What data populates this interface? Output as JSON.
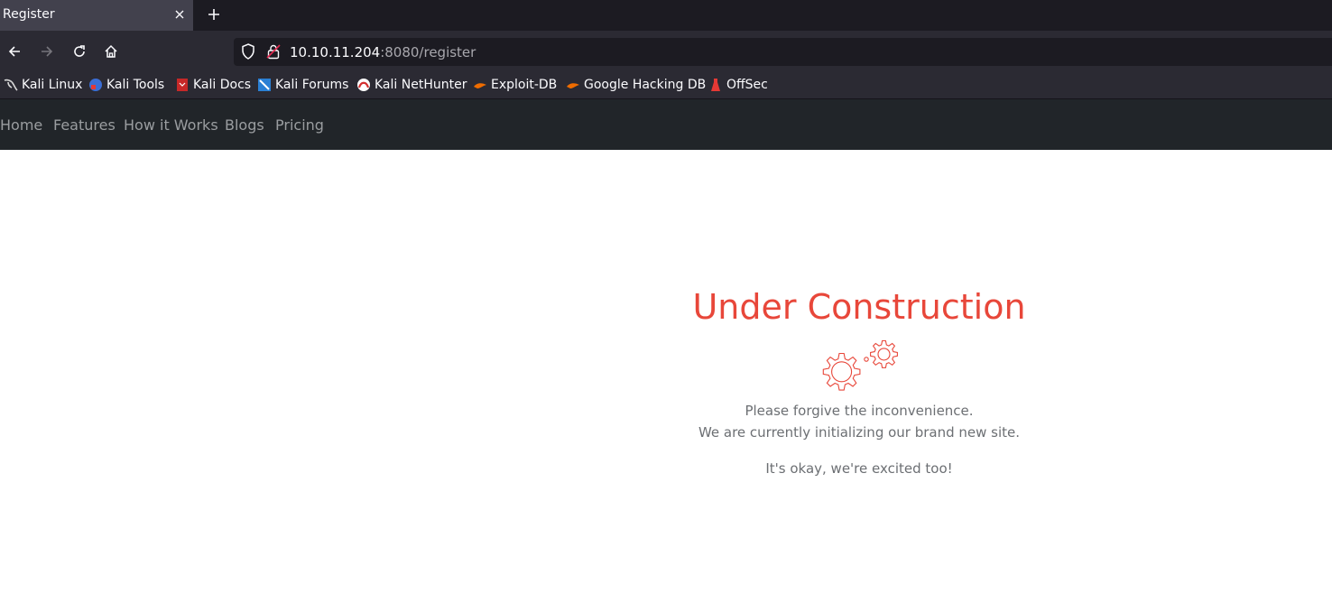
{
  "browser": {
    "tab": {
      "title": "Register"
    },
    "url": {
      "host": "10.10.11.204",
      "rest": ":8080/register"
    },
    "bookmarks": [
      {
        "label": "Kali Linux",
        "icon": "kali-dragon-icon"
      },
      {
        "label": "Kali Tools",
        "icon": "kali-tools-icon"
      },
      {
        "label": "Kali Docs",
        "icon": "kali-docs-icon"
      },
      {
        "label": "Kali Forums",
        "icon": "kali-forums-icon"
      },
      {
        "label": "Kali NetHunter",
        "icon": "nethunter-icon"
      },
      {
        "label": "Exploit-DB",
        "icon": "exploit-db-icon"
      },
      {
        "label": "Google Hacking DB",
        "icon": "ghdb-icon"
      },
      {
        "label": "OffSec",
        "icon": "offsec-icon"
      }
    ]
  },
  "site": {
    "nav": [
      "Home",
      "Features",
      "How it Works",
      "Blogs",
      "Pricing"
    ],
    "heading": "Under Construction",
    "line1": "Please forgive the inconvenience.",
    "line2": "We are currently initializing our brand new site.",
    "line3": "It's okay, we're excited too!",
    "accent_color": "#e8473a"
  }
}
